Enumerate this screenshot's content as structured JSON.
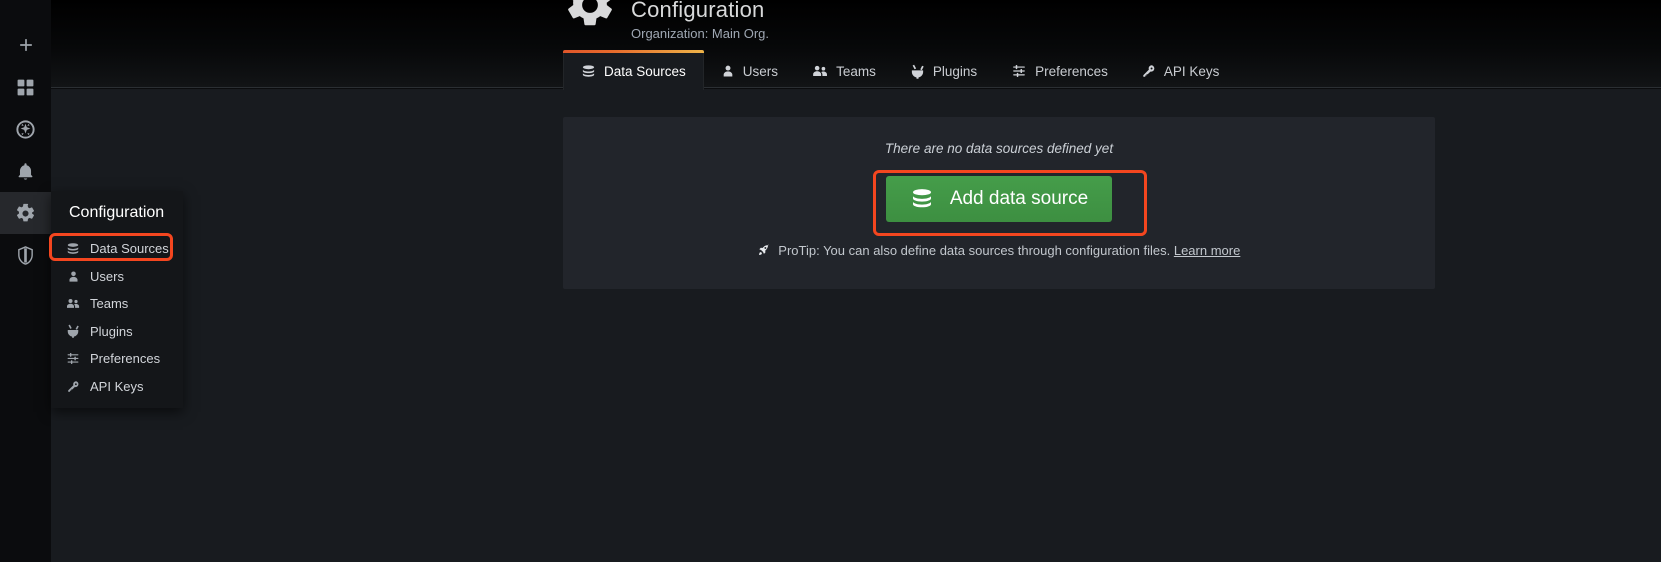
{
  "header": {
    "title": "Configuration",
    "subtitle": "Organization: Main Org.",
    "gear_icon": "gear-icon"
  },
  "rail": {
    "items": [
      {
        "name": "create-add-icon",
        "label": "Create"
      },
      {
        "name": "dashboards-icon",
        "label": "Dashboards"
      },
      {
        "name": "explore-compass-icon",
        "label": "Explore"
      },
      {
        "name": "alerting-bell-icon",
        "label": "Alerting"
      },
      {
        "name": "configuration-gear-icon",
        "label": "Configuration"
      },
      {
        "name": "server-admin-shield-icon",
        "label": "Server Admin"
      }
    ]
  },
  "tabs": [
    {
      "label": "Data Sources",
      "icon": "database-icon",
      "active": true
    },
    {
      "label": "Users",
      "icon": "user-icon",
      "active": false
    },
    {
      "label": "Teams",
      "icon": "users-icon",
      "active": false
    },
    {
      "label": "Plugins",
      "icon": "plugin-icon",
      "active": false
    },
    {
      "label": "Preferences",
      "icon": "sliders-icon",
      "active": false
    },
    {
      "label": "API Keys",
      "icon": "key-icon",
      "active": false
    }
  ],
  "panel": {
    "empty_text": "There are no data sources defined yet",
    "add_button_label": "Add data source",
    "add_button_icon": "database-icon",
    "protip_icon": "rocket-icon",
    "protip_text": "ProTip: You can also define data sources through configuration files.",
    "protip_link": "Learn more"
  },
  "dropdown": {
    "title": "Configuration",
    "items": [
      {
        "label": "Data Sources",
        "icon": "database-icon",
        "highlighted": true
      },
      {
        "label": "Users",
        "icon": "user-icon",
        "highlighted": false
      },
      {
        "label": "Teams",
        "icon": "users-icon",
        "highlighted": false
      },
      {
        "label": "Plugins",
        "icon": "plugin-icon",
        "highlighted": false
      },
      {
        "label": "Preferences",
        "icon": "sliders-icon",
        "highlighted": false
      },
      {
        "label": "API Keys",
        "icon": "key-icon",
        "highlighted": false
      }
    ]
  },
  "annotations": {
    "color": "#f4461f",
    "boxes": [
      {
        "name": "annotation-box-data-sources-menu-item"
      },
      {
        "name": "annotation-box-add-data-source-button"
      }
    ]
  }
}
